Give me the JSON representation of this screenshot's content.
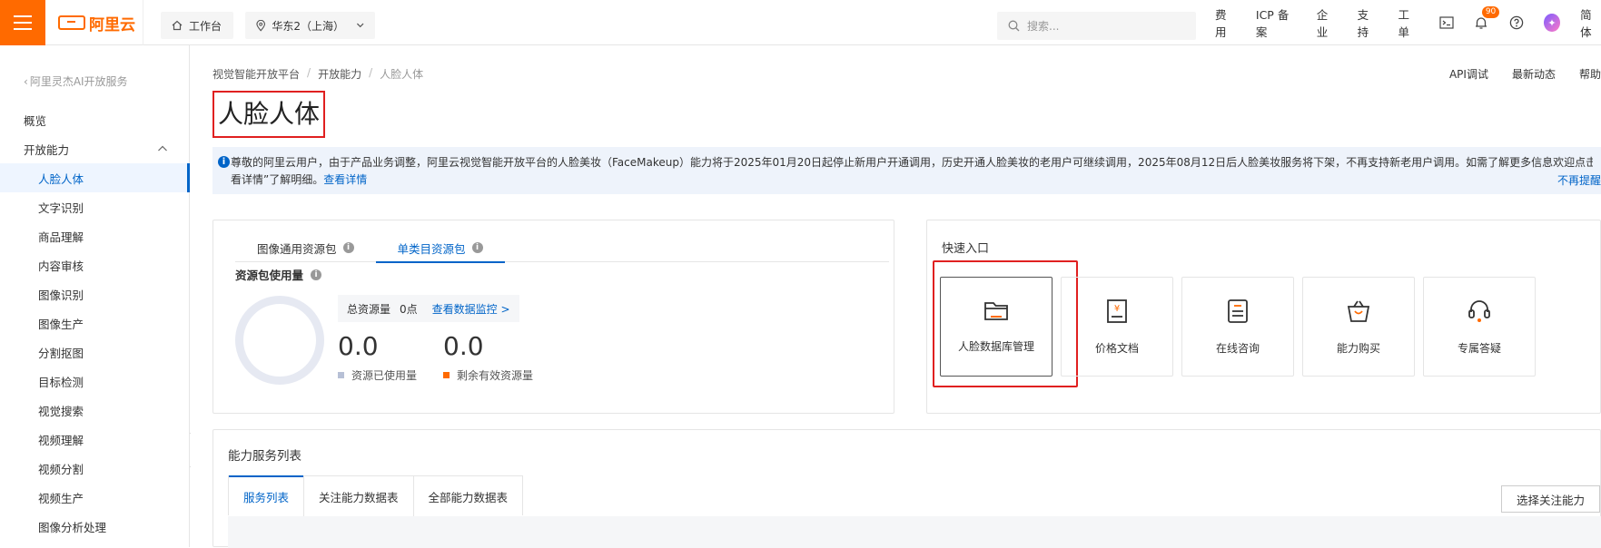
{
  "topbar": {
    "logo_text": "阿里云",
    "workbench": "工作台",
    "region": "华东2（上海）",
    "search_placeholder": "搜索...",
    "links": [
      "费用",
      "ICP 备案",
      "企业",
      "支持",
      "工单"
    ],
    "bell_count": "90",
    "lang": "简体"
  },
  "sidebar": {
    "back": "阿里灵杰AI开放服务",
    "overview": "概览",
    "section": "开放能力",
    "items": [
      "人脸人体",
      "文字识别",
      "商品理解",
      "内容审核",
      "图像识别",
      "图像生产",
      "分割抠图",
      "目标检测",
      "视觉搜索",
      "视频理解",
      "视频分割",
      "视频生产",
      "图像分析处理"
    ]
  },
  "breadcrumb": [
    "视觉智能开放平台",
    "开放能力",
    "人脸人体"
  ],
  "right_links": [
    "API调试",
    "最新动态",
    "帮助"
  ],
  "page_title": "人脸人体",
  "notice": {
    "text": "尊敬的阿里云用户，由于产品业务调整，阿里云视觉智能开放平台的人脸美妆（FaceMakeup）能力将于2025年01月20日起停止新用户开通调用，历史开通人脸美妆的老用户可继续调用，2025年08月12日后人脸美妆服务将下架，不再支持新老用户调用。如需了解更多信息欢迎点击“查",
    "text2": "看详情”了解明细。",
    "link": "查看详情",
    "right": "不再提醒"
  },
  "resource": {
    "tabs": [
      "图像通用资源包",
      "单类目资源包"
    ],
    "usage_title": "资源包使用量",
    "total_label": "总资源量",
    "total_value": "0点",
    "monitor_link": "查看数据监控 >",
    "used_value": "0.0",
    "used_label": "资源已使用量",
    "remaining_value": "0.0",
    "remaining_label": "剩余有效资源量",
    "used_color": "#b7c0d6",
    "remaining_color": "#ff6a00"
  },
  "quick": {
    "title": "快速入口",
    "tiles": [
      "人脸数据库管理",
      "价格文档",
      "在线咨询",
      "能力购买",
      "专属答疑"
    ]
  },
  "service_list": {
    "title": "能力服务列表",
    "tabs": [
      "服务列表",
      "关注能力数据表",
      "全部能力数据表"
    ],
    "select_button": "选择关注能力"
  }
}
